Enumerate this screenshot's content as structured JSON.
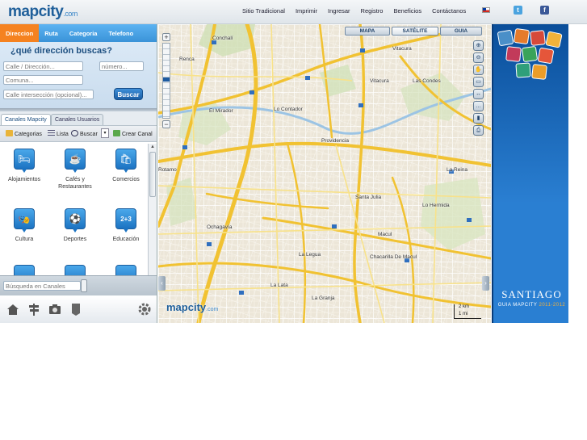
{
  "header": {
    "logo_main": "mapcity",
    "logo_suffix": ".com",
    "nav": [
      "Sitio Tradicional",
      "Imprimir",
      "Ingresar",
      "Registro",
      "Beneficios",
      "Contáctanos"
    ],
    "social": {
      "twitter": "t",
      "facebook": "f"
    }
  },
  "search": {
    "tabs": [
      "Direccion",
      "Ruta",
      "Categoria",
      "Telefono"
    ],
    "active_tab": "Direccion",
    "question": "¿qué dirección buscas?",
    "street_placeholder": "Calle / Dirección...",
    "number_placeholder": "número...",
    "comuna_placeholder": "Comuna...",
    "intersection_placeholder": "Calle intersección (opcional)...",
    "button": "Buscar"
  },
  "channels": {
    "tabs": [
      "Canales Mapcity",
      "Canales Usuarios"
    ],
    "toolbar": {
      "categorias": "Categorias",
      "lista": "Lista",
      "buscar": "Buscar",
      "crear": "Crear Canal"
    },
    "items": [
      {
        "label": "Alojamientos",
        "icon": "bed-icon",
        "glyph": "🛏"
      },
      {
        "label": "Cafés y Restaurantes",
        "icon": "coffee-cup-icon",
        "glyph": "☕"
      },
      {
        "label": "Comercios",
        "icon": "shopping-icon",
        "glyph": "🛍"
      },
      {
        "label": "Cultura",
        "icon": "theater-masks-icon",
        "glyph": "🎭"
      },
      {
        "label": "Deportes",
        "icon": "sports-icon",
        "glyph": "⚽"
      },
      {
        "label": "Educación",
        "icon": "math-icon",
        "glyph": "2+3"
      }
    ],
    "search_placeholder": "Búsqueda en Canales"
  },
  "map": {
    "tabs": [
      "MAPA",
      "SATÉLITE",
      "GUIA"
    ],
    "active_tab": "SATÉLITE",
    "places": [
      "Conchalí",
      "Vitacura",
      "Renca",
      "Vitacura",
      "Las Condes",
      "El Mirador",
      "Lo Contador",
      "Providencia",
      "Rotamo",
      "La Reina",
      "Santa Julia",
      "Lo Hermida",
      "Macul",
      "Ochagavía",
      "Chacarilla De Macul",
      "La Legua",
      "La Lata",
      "La Granja"
    ],
    "logo_main": "mapcity",
    "logo_suffix": ".com",
    "scale": {
      "km": "2 km",
      "mi": "1 mi"
    }
  },
  "ad": {
    "city": "SANTIAGO",
    "subtitle": "GUIA MAPCITY",
    "years": "2011-2012"
  },
  "colors": {
    "brand_blue": "#1f5f9a",
    "search_tab": "#3a93d8",
    "active_tab": "#f58220",
    "road_yellow": "#f6d24a",
    "ad_blue": "#2a7fd2"
  }
}
